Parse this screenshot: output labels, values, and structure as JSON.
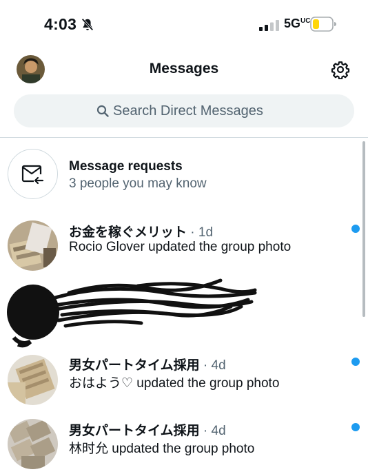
{
  "status_bar": {
    "time": "4:03",
    "network": "5G",
    "network_suffix": "UC",
    "icons": [
      "bell-slash-icon",
      "signal-icon",
      "battery-icon"
    ]
  },
  "header": {
    "title": "Messages",
    "icons": [
      "avatar",
      "gear-icon"
    ]
  },
  "search": {
    "placeholder": "Search Direct Messages",
    "icon": "search-icon"
  },
  "requests": {
    "title": "Message requests",
    "subtitle": "3 people you may know",
    "icon": "envelope-arrow-icon"
  },
  "conversations": [
    {
      "name": "お金を稼ぐメリット",
      "time": "· 1d",
      "preview": "Rocio Glover updated the group photo",
      "unread": true
    },
    {
      "name": "",
      "time": "",
      "preview": "",
      "unread": false,
      "redacted": true
    },
    {
      "name": "男女パートタイム採用",
      "time": "· 4d",
      "preview": "おはよう♡ updated the group photo",
      "unread": true
    },
    {
      "name": "男女パートタイム採用",
      "time": "· 4d",
      "preview": "林时允 updated the group photo",
      "unread": true
    }
  ],
  "colors": {
    "accent": "#1d9bf0",
    "search_bg": "#eff3f4",
    "muted_text": "#536471",
    "battery_fill": "#ffd60a"
  }
}
